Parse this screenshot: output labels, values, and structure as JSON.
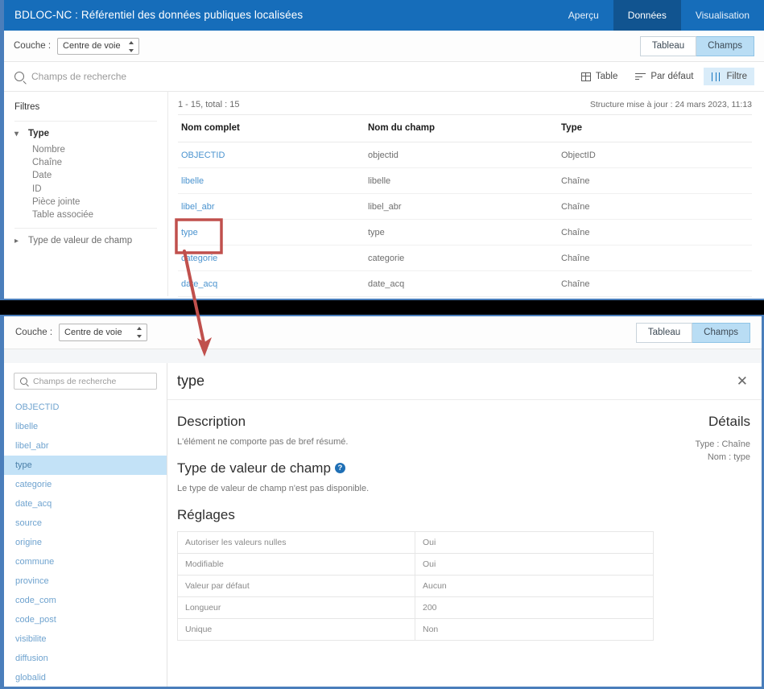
{
  "header": {
    "title": "BDLOC-NC : Référentiel des données publiques localisées",
    "tabs": [
      {
        "label": "Aperçu",
        "active": false
      },
      {
        "label": "Données",
        "active": true
      },
      {
        "label": "Visualisation",
        "active": false
      }
    ],
    "bg_color": "#166dba",
    "active_tab_color": "#115490"
  },
  "toolbar": {
    "layer_label": "Couche :",
    "layer_value": "Centre de voie",
    "view_buttons": [
      {
        "label": "Tableau",
        "active": false
      },
      {
        "label": "Champs",
        "active": true
      }
    ]
  },
  "search": {
    "placeholder": "Champs de recherche",
    "icon": "search-icon"
  },
  "tools": [
    {
      "label": "Table",
      "icon": "table-icon",
      "active": false
    },
    {
      "label": "Par défaut",
      "icon": "sort-icon",
      "active": false
    },
    {
      "label": "Filtre",
      "icon": "filter-icon",
      "active": true
    }
  ],
  "filters": {
    "title": "Filtres",
    "groups": [
      {
        "label": "Type",
        "expanded": true,
        "chevron": "chevron-down-icon",
        "options": [
          "Nombre",
          "Chaîne",
          "Date",
          "ID",
          "Pièce jointe",
          "Table associée"
        ]
      },
      {
        "label": "Type de valeur de champ",
        "expanded": false,
        "chevron": "chevron-right-icon",
        "options": []
      }
    ]
  },
  "table": {
    "count_text": "1 - 15, total : 15",
    "updated_text": "Structure mise à jour : 24 mars 2023, 11:13",
    "columns": [
      "Nom complet",
      "Nom du champ",
      "Type"
    ],
    "rows": [
      {
        "full_name": "OBJECTID",
        "field_name": "objectid",
        "type": "ObjectID"
      },
      {
        "full_name": "libelle",
        "field_name": "libelle",
        "type": "Chaîne"
      },
      {
        "full_name": "libel_abr",
        "field_name": "libel_abr",
        "type": "Chaîne"
      },
      {
        "full_name": "type",
        "field_name": "type",
        "type": "Chaîne"
      },
      {
        "full_name": "categorie",
        "field_name": "categorie",
        "type": "Chaîne"
      },
      {
        "full_name": "date_acq",
        "field_name": "date_acq",
        "type": "Chaîne"
      }
    ]
  },
  "bottom": {
    "toolbar": {
      "layer_label": "Couche :",
      "layer_value": "Centre de voie",
      "view_buttons": [
        {
          "label": "Tableau",
          "active": false
        },
        {
          "label": "Champs",
          "active": true
        }
      ]
    },
    "search": {
      "placeholder": "Champs de recherche",
      "icon": "search-icon"
    },
    "field_list": [
      {
        "label": "OBJECTID",
        "selected": false
      },
      {
        "label": "libelle",
        "selected": false
      },
      {
        "label": "libel_abr",
        "selected": false
      },
      {
        "label": "type",
        "selected": true
      },
      {
        "label": "categorie",
        "selected": false
      },
      {
        "label": "date_acq",
        "selected": false
      },
      {
        "label": "source",
        "selected": false
      },
      {
        "label": "origine",
        "selected": false
      },
      {
        "label": "commune",
        "selected": false
      },
      {
        "label": "province",
        "selected": false
      },
      {
        "label": "code_com",
        "selected": false
      },
      {
        "label": "code_post",
        "selected": false
      },
      {
        "label": "visibilite",
        "selected": false
      },
      {
        "label": "diffusion",
        "selected": false
      },
      {
        "label": "globalid",
        "selected": false
      }
    ],
    "detail": {
      "title": "type",
      "close_icon": "close-icon",
      "description_heading": "Description",
      "description_text": "L'élément ne comporte pas de bref résumé.",
      "fieldvalue_heading": "Type de valeur de champ",
      "fieldvalue_help_icon": "help-icon",
      "fieldvalue_text": "Le type de valeur de champ n'est pas disponible.",
      "settings_heading": "Réglages",
      "settings": [
        {
          "key": "Autoriser les valeurs nulles",
          "value": "Oui"
        },
        {
          "key": "Modifiable",
          "value": "Oui"
        },
        {
          "key": "Valeur par défaut",
          "value": "Aucun"
        },
        {
          "key": "Longueur",
          "value": "200"
        },
        {
          "key": "Unique",
          "value": "Non"
        }
      ],
      "details_heading": "Détails",
      "details_lines": [
        "Type : Chaîne",
        "Nom : type"
      ]
    }
  },
  "annotation": {
    "color": "#c0504d",
    "highlight_target": "type",
    "shape": "red-box-with-arrow"
  }
}
